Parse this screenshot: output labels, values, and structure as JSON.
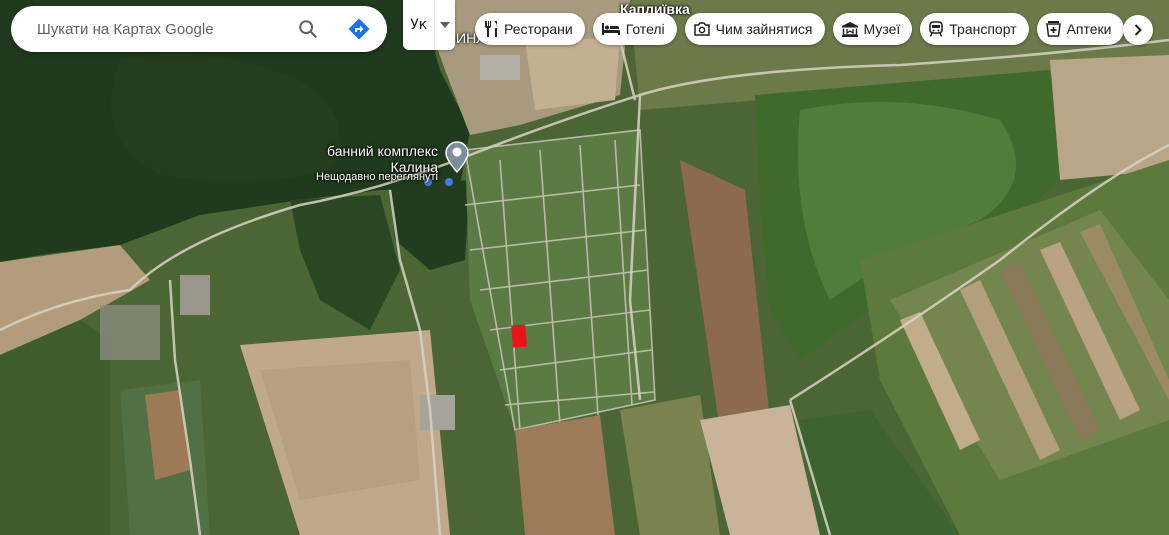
{
  "search": {
    "placeholder": "Шукати на Картах Google"
  },
  "layers": {
    "label": "Ук"
  },
  "chips": [
    {
      "label": "Ресторани",
      "icon": "restaurant-icon"
    },
    {
      "label": "Готелі",
      "icon": "hotel-icon"
    },
    {
      "label": "Чим зайнятися",
      "icon": "camera-icon"
    },
    {
      "label": "Музеї",
      "icon": "museum-icon"
    },
    {
      "label": "Транспорт",
      "icon": "transit-icon"
    },
    {
      "label": "Аптеки",
      "icon": "pharmacy-icon"
    }
  ],
  "places": {
    "village": "Каплиївка",
    "partial_label": "ИНЛ",
    "poi_line1": "банний комплекс",
    "poi_line2": "Калина",
    "poi_status": "Нещодавно переглянуті"
  },
  "colors": {
    "marked_plot": "#e8141c",
    "route_blue": "#4285f4"
  }
}
